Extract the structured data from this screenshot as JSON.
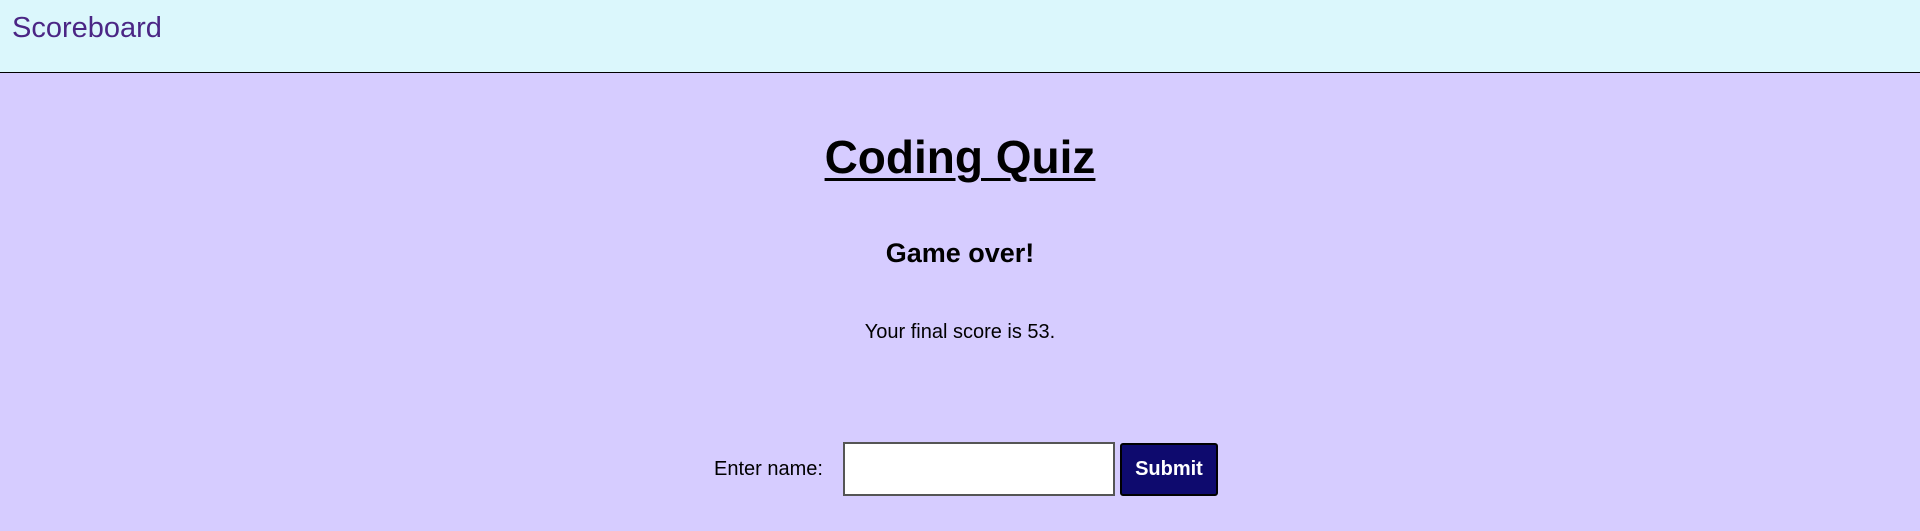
{
  "header": {
    "scoreboard_link": "Scoreboard"
  },
  "main": {
    "title": "Coding Quiz",
    "subtitle": "Game over!",
    "score_text": "Your final score is 53."
  },
  "form": {
    "name_label": "Enter name:",
    "name_value": "",
    "submit_label": "Submit"
  },
  "colors": {
    "header_bg": "#dbf7fc",
    "page_bg": "#d6ccff",
    "link_color": "#4b2685",
    "button_bg": "#0e0a6e",
    "button_text": "#ffffff"
  }
}
